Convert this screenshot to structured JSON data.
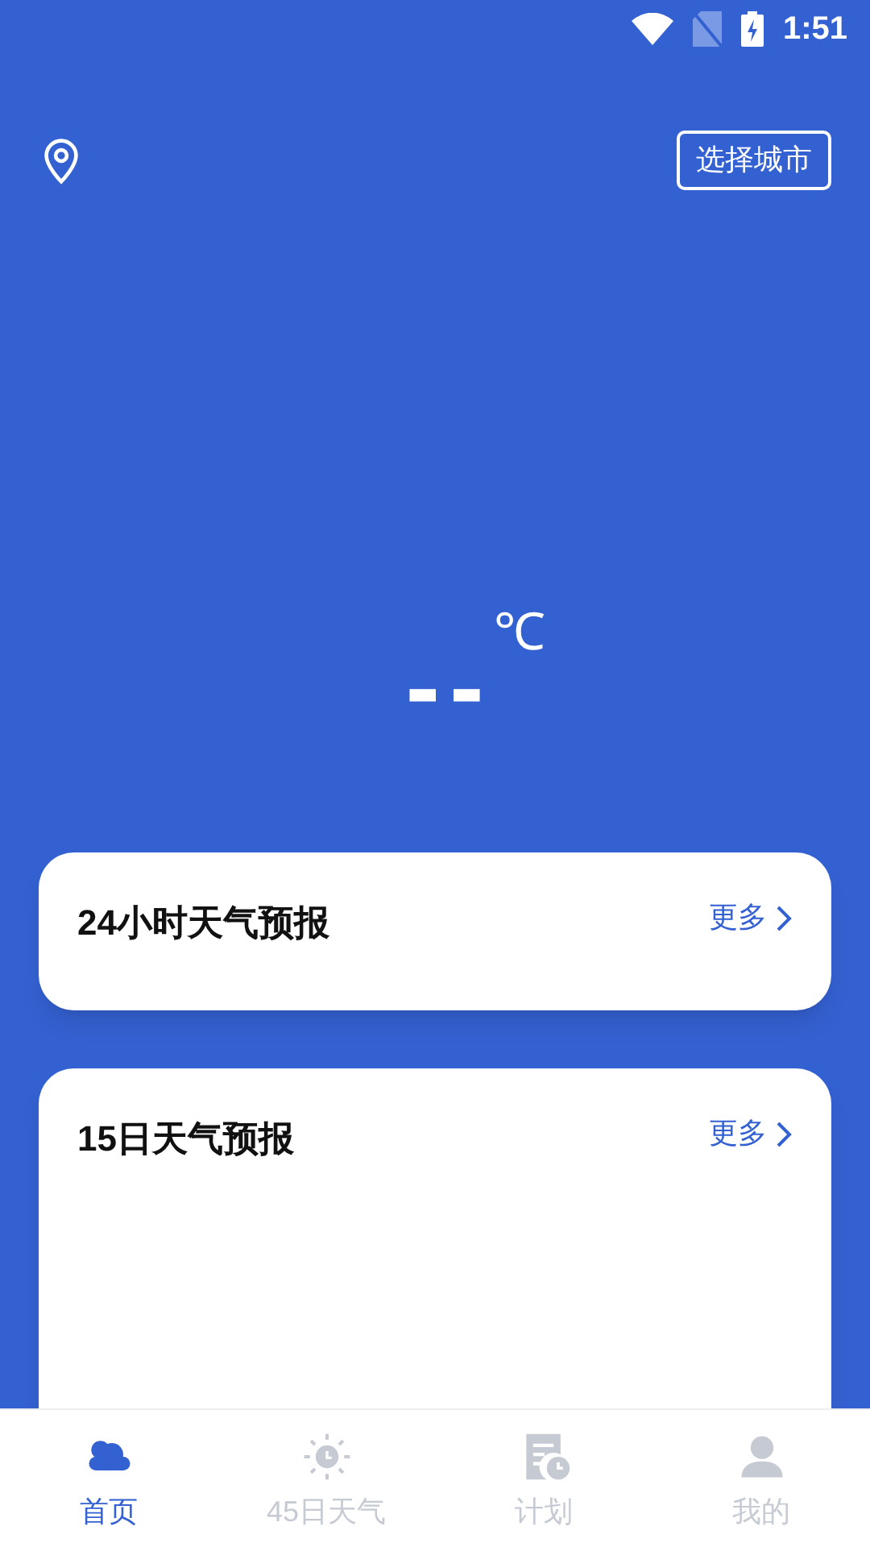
{
  "status_bar": {
    "time": "1:51"
  },
  "header": {
    "city_button": "选择城市"
  },
  "current": {
    "temperature": "--",
    "unit": "℃"
  },
  "cards": [
    {
      "title": "24小时天气预报",
      "more": "更多"
    },
    {
      "title": "15日天气预报",
      "more": "更多"
    }
  ],
  "tabs": [
    {
      "label": "首页",
      "kind": "cloud",
      "selected": true
    },
    {
      "label": "45日天气",
      "kind": "sun",
      "selected": false
    },
    {
      "label": "计划",
      "kind": "plan",
      "selected": false
    },
    {
      "label": "我的",
      "kind": "user",
      "selected": false
    }
  ]
}
